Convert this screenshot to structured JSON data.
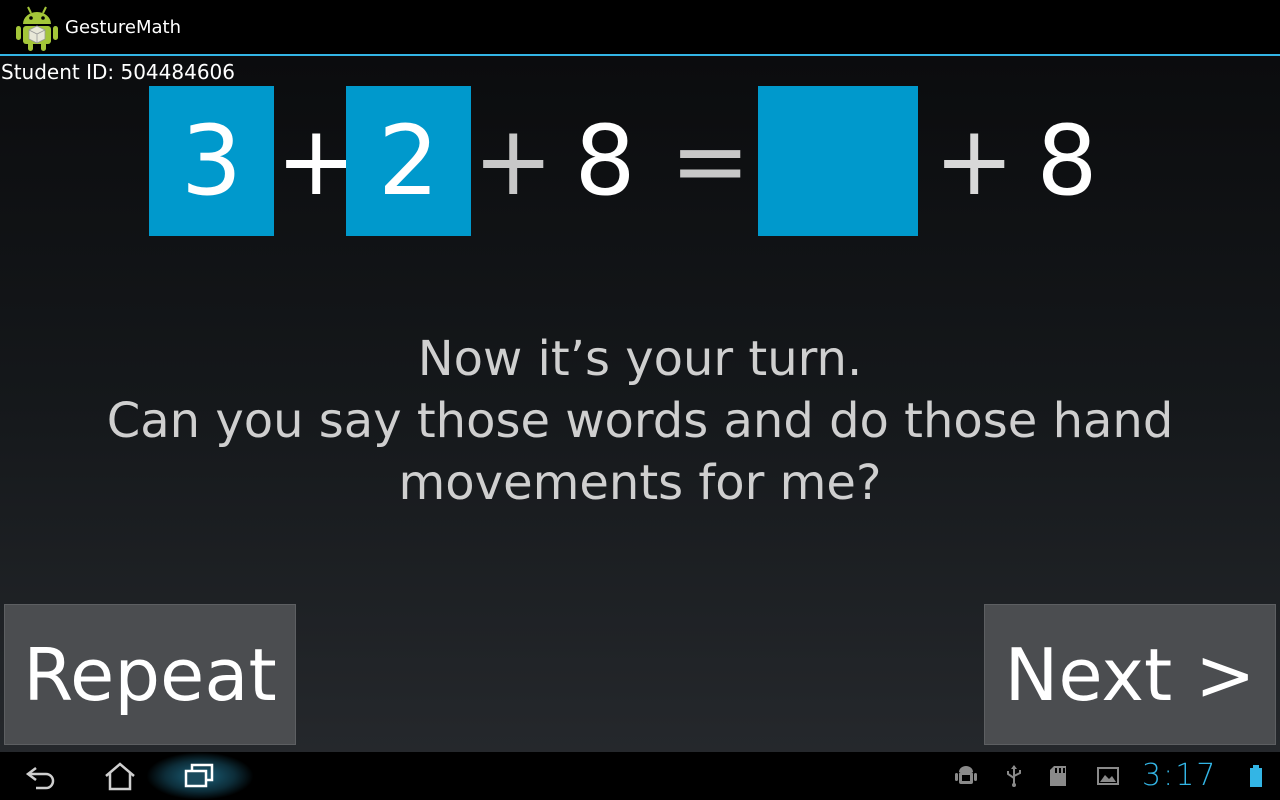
{
  "app": {
    "title": "GestureMath",
    "icon": "android-icon"
  },
  "student": {
    "label": "Student ID: 504484606"
  },
  "equation": {
    "term1": "3",
    "op1": "+",
    "term2": "2",
    "op2": "+",
    "term3": "8",
    "equals": "=",
    "blank": "",
    "op3": "+",
    "term4": "8"
  },
  "prompt": {
    "line1": "Now it’s your turn.",
    "line2": "Can you say those words and do those hand",
    "line3": "movements for me?"
  },
  "buttons": {
    "repeat": "Repeat",
    "next": "Next >"
  },
  "system_bar": {
    "nav": [
      "back-icon",
      "home-icon",
      "recents-icon"
    ],
    "status_icons": [
      "android-debug-icon",
      "usb-icon",
      "sd-card-icon",
      "screenshot-icon",
      "battery-icon"
    ],
    "clock": "3:17"
  },
  "colors": {
    "accent": "#0099cc",
    "holo_blue": "#33b5e5",
    "button_bg": "#4b4d50"
  }
}
